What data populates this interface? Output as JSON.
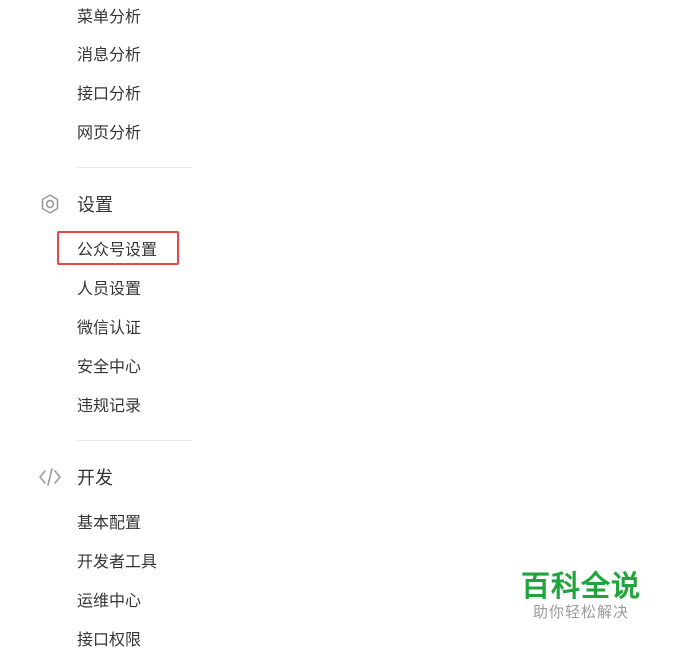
{
  "analysis_items": [
    {
      "label": "菜单分析"
    },
    {
      "label": "消息分析"
    },
    {
      "label": "接口分析"
    },
    {
      "label": "网页分析"
    }
  ],
  "settings": {
    "icon": "gear-icon",
    "title": "设置",
    "items": [
      {
        "label": "公众号设置"
      },
      {
        "label": "人员设置"
      },
      {
        "label": "微信认证"
      },
      {
        "label": "安全中心"
      },
      {
        "label": "违规记录"
      }
    ]
  },
  "develop": {
    "icon": "code-icon",
    "title": "开发",
    "items": [
      {
        "label": "基本配置"
      },
      {
        "label": "开发者工具"
      },
      {
        "label": "运维中心"
      },
      {
        "label": "接口权限"
      }
    ]
  },
  "watermark": {
    "title": "百科全说",
    "subtitle": "助你轻松解决"
  },
  "colors": {
    "text": "#353535",
    "icon": "#9a9a9a",
    "divider": "#e7e7eb",
    "highlight": "#e24a4a",
    "watermark_green": "#1fa53c"
  }
}
